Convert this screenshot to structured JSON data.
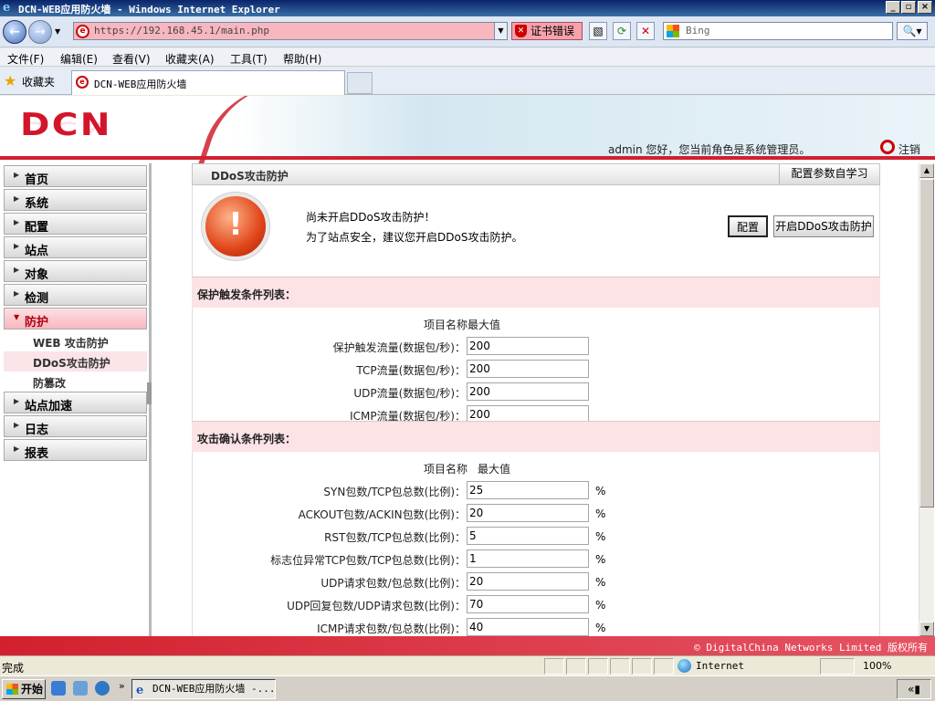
{
  "window": {
    "title": "DCN-WEB应用防火墙 - Windows Internet Explorer"
  },
  "addressbar": {
    "url": "https://192.168.45.1/main.php",
    "cert_error": "证书错误",
    "search_placeholder": "Bing"
  },
  "menubar": {
    "items": [
      "文件(F)",
      "编辑(E)",
      "查看(V)",
      "收藏夹(A)",
      "工具(T)",
      "帮助(H)"
    ]
  },
  "favbar": {
    "label": "收藏夹",
    "tab_title": "DCN-WEB应用防火墙"
  },
  "header": {
    "logo": "DCN",
    "welcome": "admin 您好，您当前角色是系统管理员。",
    "logout": "注销"
  },
  "sidebar": {
    "items": [
      {
        "label": "首页"
      },
      {
        "label": "系统"
      },
      {
        "label": "配置"
      },
      {
        "label": "站点"
      },
      {
        "label": "对象"
      },
      {
        "label": "检测"
      },
      {
        "label": "防护"
      },
      {
        "label": "站点加速"
      },
      {
        "label": "日志"
      },
      {
        "label": "报表"
      }
    ],
    "subitems": [
      {
        "label": "WEB 攻击防护"
      },
      {
        "label": "DDoS攻击防护"
      },
      {
        "label": "防篡改"
      }
    ]
  },
  "panel": {
    "title": "DDoS攻击防护",
    "learn_button": "配置参数自学习",
    "alert_line1": "尚未开启DDoS攻击防护！",
    "alert_line2": "为了站点安全，建议您开启DDoS攻击防护。",
    "config_button": "配置",
    "enable_button": "开启DDoS攻击防护"
  },
  "trigger_section": {
    "title": "保护触发条件列表：",
    "col_header": "项目名称最大值",
    "rows": [
      {
        "label": "保护触发流量(数据包/秒)：",
        "value": "200"
      },
      {
        "label": "TCP流量(数据包/秒)：",
        "value": "200"
      },
      {
        "label": "UDP流量(数据包/秒)：",
        "value": "200"
      },
      {
        "label": "ICMP流量(数据包/秒)：",
        "value": "200"
      }
    ]
  },
  "confirm_section": {
    "title": "攻击确认条件列表：",
    "col_name": "项目名称",
    "col_max": "最大值",
    "unit": "%",
    "rows": [
      {
        "label": "SYN包数/TCP包总数(比例)：",
        "value": "25"
      },
      {
        "label": "ACKOUT包数/ACKIN包数(比例)：",
        "value": "20"
      },
      {
        "label": "RST包数/TCP包总数(比例)：",
        "value": "5"
      },
      {
        "label": "标志位异常TCP包数/TCP包总数(比例)：",
        "value": "1"
      },
      {
        "label": "UDP请求包数/包总数(比例)：",
        "value": "20"
      },
      {
        "label": "UDP回复包数/UDP请求包数(比例)：",
        "value": "70"
      },
      {
        "label": "ICMP请求包数/包总数(比例)：",
        "value": "40"
      }
    ]
  },
  "footer": {
    "copyright": "© DigitalChina Networks Limited 版权所有"
  },
  "statusbar": {
    "status": "完成",
    "zone": "Internet",
    "zoom": "100%"
  },
  "taskbar": {
    "start": "开始",
    "window_button": "DCN-WEB应用防火墙 -..."
  },
  "colors": {
    "brand_red": "#d3152a",
    "section_pink": "#fbe3e6",
    "active_nav": "#f7b7bf"
  }
}
